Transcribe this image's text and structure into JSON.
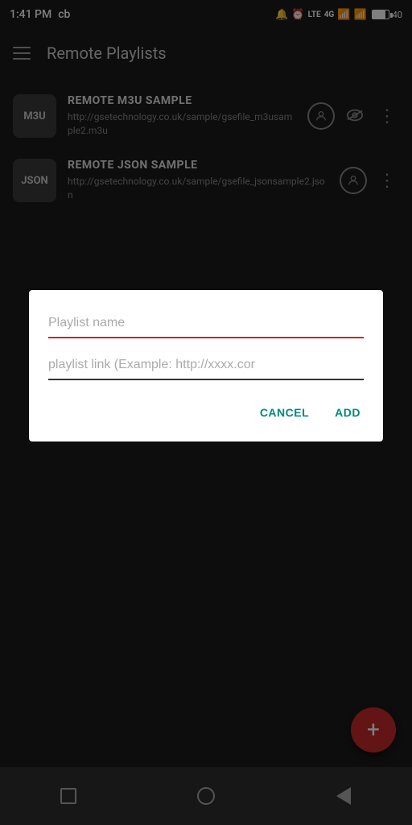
{
  "statusBar": {
    "time": "1:41 PM",
    "carrier": "cb"
  },
  "appBar": {
    "title": "Remote Playlists"
  },
  "playlists": [
    {
      "badge": "M3U",
      "name": "REMOTE M3U SAMPLE",
      "url": "http://gsetechnology.co.uk/sample/gsefile_m3usample2.m3u"
    },
    {
      "badge": "JSON",
      "name": "REMOTE JSON SAMPLE",
      "url": "http://gsetechnology.co.uk/sample/gsefile_jsonsample2.json"
    }
  ],
  "dialog": {
    "namePlaceholder": "Playlist name",
    "linkPlaceholder": "playlist link (Example: http://xxxx.cor",
    "cancelLabel": "CANCEL",
    "addLabel": "ADD"
  },
  "fab": {
    "label": "+"
  }
}
